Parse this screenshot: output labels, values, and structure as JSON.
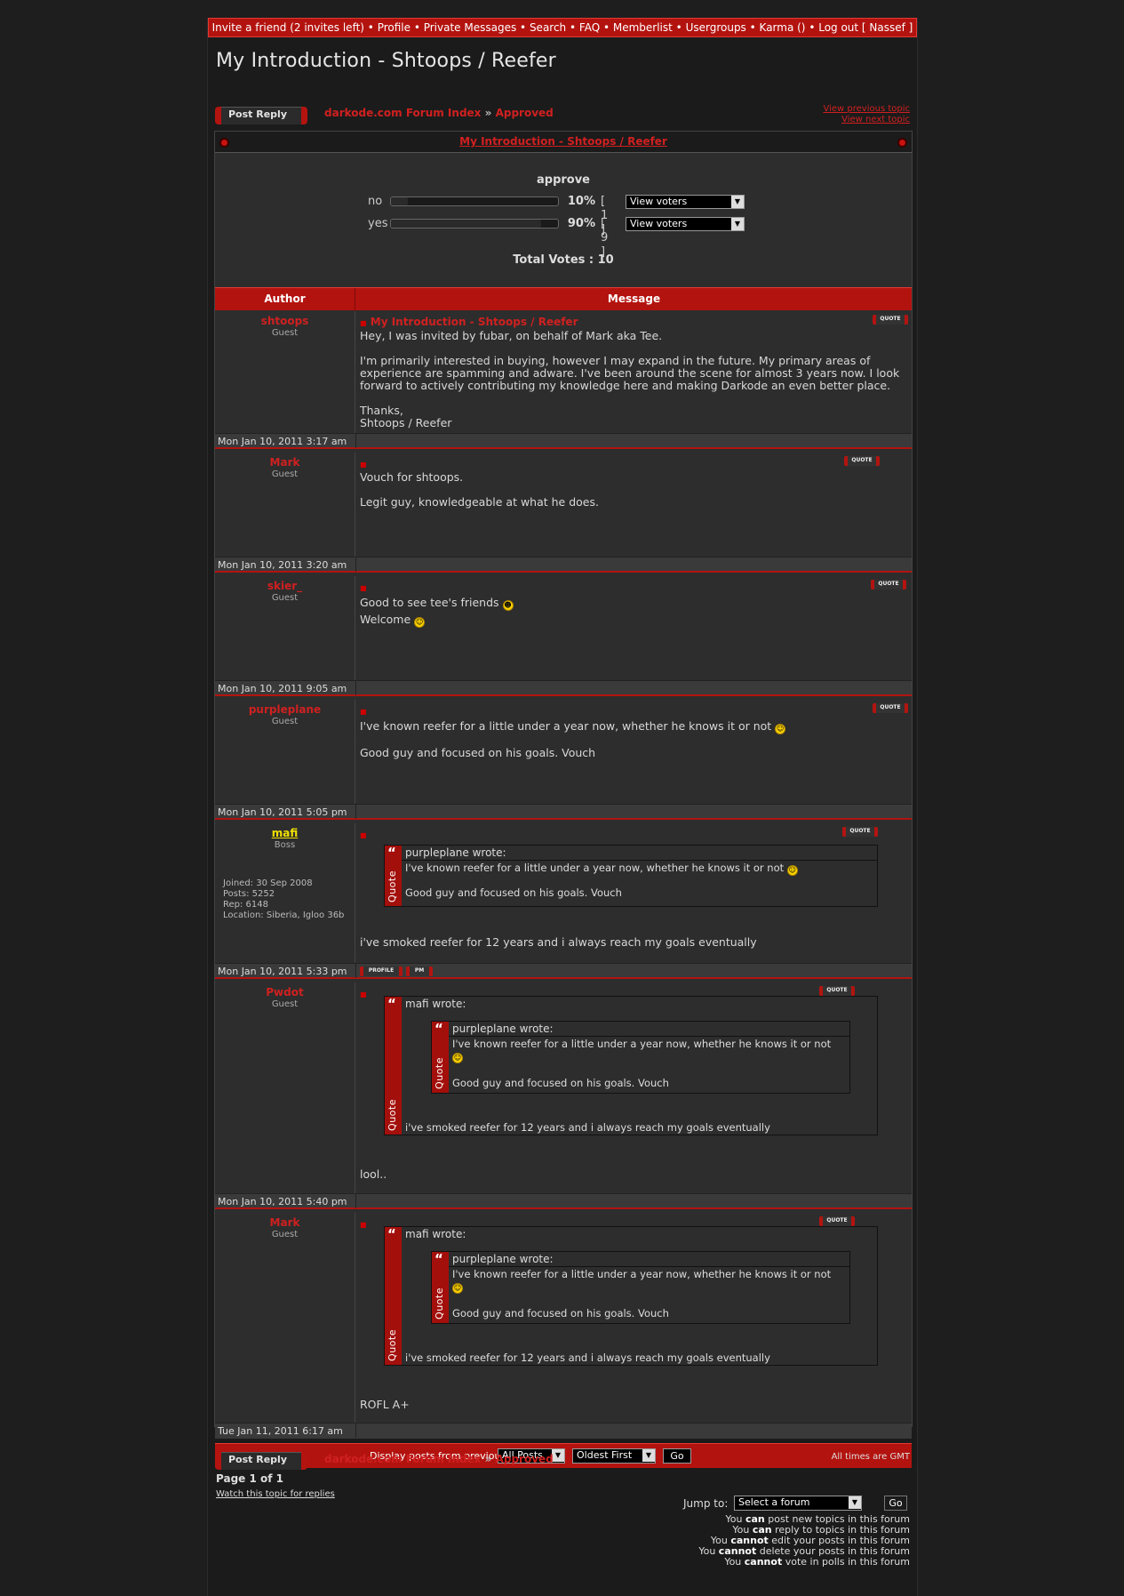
{
  "topnav": {
    "items": [
      "Invite a friend (2 invites left)",
      "Profile",
      "Private Messages",
      "Search",
      "FAQ",
      "Memberlist",
      "Usergroups",
      "Karma ()",
      "Log out [ Nassef ]"
    ],
    "separator": " • "
  },
  "page": {
    "title": "My Introduction - Shtoops / Reefer",
    "post_reply_label": "Post Reply",
    "breadcrumb": {
      "index": "darkode.com Forum Index",
      "sep": "»",
      "forum": "Approved"
    },
    "view_previous": "View previous topic",
    "view_next": "View next topic",
    "topic_header": "My Introduction - Shtoops / Reefer"
  },
  "poll": {
    "question": "approve",
    "options": [
      {
        "label": "no",
        "percent_text": "10%",
        "count_text": "[ 1 ]",
        "fraction": 0.1,
        "voters_label": "View voters"
      },
      {
        "label": "yes",
        "percent_text": "90%",
        "count_text": "[ 9 ]",
        "fraction": 0.9,
        "voters_label": "View voters"
      }
    ],
    "total": "Total Votes : 10"
  },
  "table": {
    "author_header": "Author",
    "message_header": "Message"
  },
  "quote_btn": "QUOTE",
  "posts": [
    {
      "author": "shtoops",
      "rank": "Guest",
      "subject": "My Introduction - Shtoops / Reefer",
      "body": [
        "Hey, I was invited by fubar, on behalf of Mark aka Tee.",
        "I'm primarily interested in buying, however I may expand in the future. My primary areas of experience are spamming and adware. I've been around the scene for almost 3 years now. I look forward to actively contributing my knowledge here and making Darkode an even better place.",
        "Thanks,",
        "Shtoops / Reefer"
      ],
      "date": "Mon Jan 10, 2011 3:17 am"
    },
    {
      "author": "Mark",
      "rank": "Guest",
      "body": [
        "Vouch for shtoops.",
        "Legit guy, knowledgeable at what he does."
      ],
      "date": "Mon Jan 10, 2011 3:20 am"
    },
    {
      "author": "skier_",
      "rank": "Guest",
      "body": [
        "Good to see tee's friends",
        "Welcome"
      ],
      "date": "Mon Jan 10, 2011 9:05 am"
    },
    {
      "author": "purpleplane",
      "rank": "Guest",
      "body": [
        "I've known reefer for a little under a year now, whether he knows it or not",
        "Good guy and focused on his goals. Vouch"
      ],
      "date": "Mon Jan 10, 2011 5:05 pm"
    },
    {
      "author": "mafi",
      "rank": "Boss",
      "info": [
        "Joined: 30 Sep 2008",
        "Posts: 5252",
        "Rep: 6148",
        "Location: Siberia, Igloo 36b"
      ],
      "quote": {
        "author": "purpleplane wrote:",
        "lines": [
          "I've known reefer for a little under a year now, whether he knows it or not",
          "Good guy and focused on his goals. Vouch"
        ]
      },
      "body": [
        "i've smoked reefer for 12 years and i always reach my goals eventually"
      ],
      "date": "Mon Jan 10, 2011 5:33 pm",
      "profile_btn": "PROFILE",
      "pm_btn": "PM"
    },
    {
      "author": "Pwdot",
      "rank": "Guest",
      "quote": {
        "author": "mafi wrote:",
        "inner_author": "purpleplane wrote:",
        "inner_lines": [
          "I've known reefer for a little under a year now, whether he knows it or not",
          "Good guy and focused on his goals. Vouch"
        ],
        "after": "i've smoked reefer for 12 years and i always reach my goals eventually"
      },
      "body": [
        "lool.."
      ],
      "date": "Mon Jan 10, 2011 5:40 pm"
    },
    {
      "author": "Mark",
      "rank": "Guest",
      "quote": {
        "author": "mafi wrote:",
        "inner_author": "purpleplane wrote:",
        "inner_lines": [
          "I've known reefer for a little under a year now, whether he knows it or not",
          "Good guy and focused on his goals. Vouch"
        ],
        "after": "i've smoked reefer for 12 years and i always reach my goals eventually"
      },
      "body": [
        "ROFL A+"
      ],
      "date": "Tue Jan 11, 2011 6:17 am"
    }
  ],
  "quote_label": "Quote",
  "display": {
    "label": "Display posts from previous:",
    "posts_select": "All Posts",
    "order_select": "Oldest First",
    "go": "Go"
  },
  "footer": {
    "timezone": "All times are GMT",
    "page_info": "Page 1 of 1",
    "watch": "Watch this topic for replies",
    "jump_label": "Jump to:",
    "jump_select": "Select a forum",
    "jump_go": "Go",
    "permissions": [
      {
        "pre": "You ",
        "b": "can",
        "post": " post new topics in this forum"
      },
      {
        "pre": "You ",
        "b": "can",
        "post": " reply to topics in this forum"
      },
      {
        "pre": "You ",
        "b": "cannot",
        "post": " edit your posts in this forum"
      },
      {
        "pre": "You ",
        "b": "cannot",
        "post": " delete your posts in this forum"
      },
      {
        "pre": "You ",
        "b": "cannot",
        "post": " vote in polls in this forum"
      }
    ]
  },
  "colors": {
    "accent": "#b3130f",
    "link": "#d02020",
    "background": "#1e1e1e",
    "panel": "#2d2d2d",
    "boss": "#f0e000"
  }
}
